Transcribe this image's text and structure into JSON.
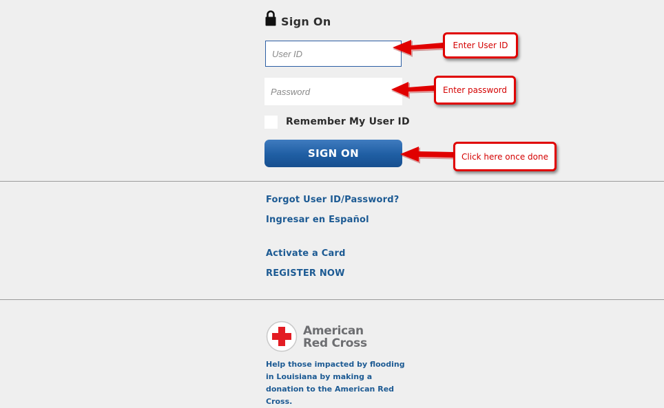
{
  "signon": {
    "title": "Sign On",
    "userid_placeholder": "User ID",
    "password_placeholder": "Password",
    "remember_label": "Remember My User ID",
    "button_label": "SIGN ON"
  },
  "links": {
    "forgot": "Forgot User ID/Password?",
    "espanol": "Ingresar en Español",
    "activate": "Activate a Card",
    "register": "REGISTER NOW"
  },
  "red_cross": {
    "name_line1": "American",
    "name_line2": "Red Cross",
    "message_part1": "Help those impacted by flooding in Louisiana by making a donation to the",
    "message_part2": "American Red Cross."
  },
  "callouts": {
    "userid": "Enter User ID",
    "password": "Enter password",
    "done": "Click here once done"
  },
  "colors": {
    "page_background": "#efefef",
    "link_blue": "#1c5a93",
    "button_blue": "#1f5ea3",
    "callout_red": "#e00000",
    "red_cross_red": "#e31c23"
  },
  "icons": {
    "lock": "lock-icon",
    "red_cross_logo": "red-cross-logo",
    "arrow": "arrow-left-icon"
  }
}
